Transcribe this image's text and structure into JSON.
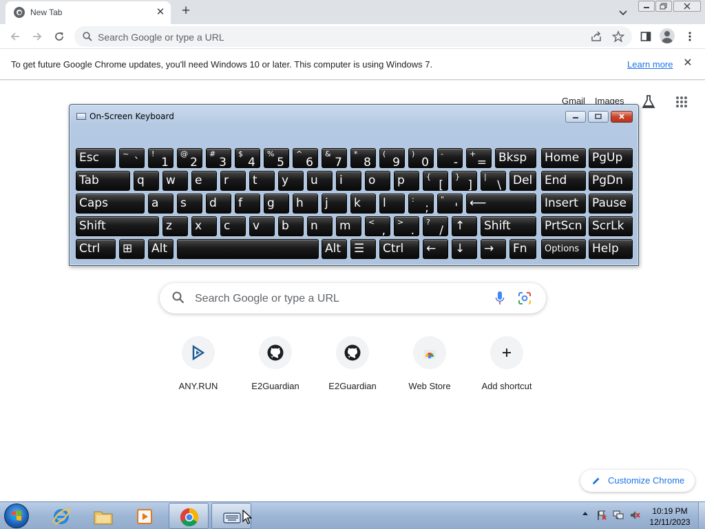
{
  "browser": {
    "tab_title": "New Tab",
    "tab_close": "✕",
    "new_tab": "+",
    "omnibox_placeholder": "Search Google or type a URL"
  },
  "infobar": {
    "message": "To get future Google Chrome updates, you'll need Windows 10 or later. This computer is using Windows 7.",
    "link": "Learn more",
    "close": "✕"
  },
  "ntp": {
    "links": [
      "Gmail",
      "Images"
    ],
    "search_placeholder": "Search Google or type a URL",
    "shortcuts": [
      {
        "label": "ANY.RUN",
        "icon": "anyrun-icon"
      },
      {
        "label": "E2Guardian",
        "icon": "github-icon"
      },
      {
        "label": "E2Guardian",
        "icon": "github-icon"
      },
      {
        "label": "Web Store",
        "icon": "webstore-icon"
      },
      {
        "label": "Add shortcut",
        "icon": "plus-icon"
      }
    ],
    "customize_label": "Customize Chrome"
  },
  "osk": {
    "title": "On-Screen Keyboard",
    "keys": [
      {
        "label": "Esc"
      },
      {
        "top": "~",
        "bot": "`"
      },
      {
        "top": "!",
        "bot": "1"
      },
      {
        "top": "@",
        "bot": "2"
      },
      {
        "top": "#",
        "bot": "3"
      },
      {
        "top": "$",
        "bot": "4"
      },
      {
        "top": "%",
        "bot": "5"
      },
      {
        "top": "^",
        "bot": "6"
      },
      {
        "top": "&",
        "bot": "7"
      },
      {
        "top": "*",
        "bot": "8"
      },
      {
        "top": "(",
        "bot": "9"
      },
      {
        "top": ")",
        "bot": "0"
      },
      {
        "top": "-",
        "bot": "-"
      },
      {
        "top": "+",
        "bot": "="
      },
      {
        "label": "Bksp"
      },
      {
        "label": "Home"
      },
      {
        "label": "PgUp"
      },
      {
        "label": "Tab"
      },
      {
        "label": "q"
      },
      {
        "label": "w"
      },
      {
        "label": "e"
      },
      {
        "label": "r"
      },
      {
        "label": "t"
      },
      {
        "label": "y"
      },
      {
        "label": "u"
      },
      {
        "label": "i"
      },
      {
        "label": "o"
      },
      {
        "label": "p"
      },
      {
        "top": "{",
        "bot": "["
      },
      {
        "top": "}",
        "bot": "]"
      },
      {
        "top": "|",
        "bot": "\\"
      },
      {
        "label": "Del"
      },
      {
        "label": "End"
      },
      {
        "label": "PgDn"
      },
      {
        "label": "Caps"
      },
      {
        "label": "a"
      },
      {
        "label": "s"
      },
      {
        "label": "d"
      },
      {
        "label": "f"
      },
      {
        "label": "g"
      },
      {
        "label": "h"
      },
      {
        "label": "j"
      },
      {
        "label": "k"
      },
      {
        "label": "l"
      },
      {
        "top": ":",
        "bot": ";"
      },
      {
        "top": "\"",
        "bot": "'"
      },
      {
        "label": "⟵"
      },
      {
        "label": "Insert"
      },
      {
        "label": "Pause"
      },
      {
        "label": "Shift"
      },
      {
        "label": "z"
      },
      {
        "label": "x"
      },
      {
        "label": "c"
      },
      {
        "label": "v"
      },
      {
        "label": "b"
      },
      {
        "label": "n"
      },
      {
        "label": "m"
      },
      {
        "top": "<",
        "bot": ","
      },
      {
        "top": ">",
        "bot": "."
      },
      {
        "top": "?",
        "bot": "/"
      },
      {
        "label": "↑"
      },
      {
        "label": "Shift"
      },
      {
        "label": "PrtScn"
      },
      {
        "label": "ScrLk"
      },
      {
        "label": "Ctrl"
      },
      {
        "label": "⊞"
      },
      {
        "label": "Alt"
      },
      {
        "label": ""
      },
      {
        "label": "Alt"
      },
      {
        "label": "☰"
      },
      {
        "label": "Ctrl"
      },
      {
        "label": "←"
      },
      {
        "label": "↓"
      },
      {
        "label": "→"
      },
      {
        "label": "Fn"
      },
      {
        "label": "Options"
      },
      {
        "label": "Help"
      }
    ]
  },
  "taskbar": {
    "time": "10:19 PM",
    "date": "12/11/2023"
  },
  "colors": {
    "chrome_frame": "#dee1e6",
    "link_blue": "#1a73e8",
    "osk_key": "#1a1a1a",
    "taskbar": "#9fb7d6"
  }
}
